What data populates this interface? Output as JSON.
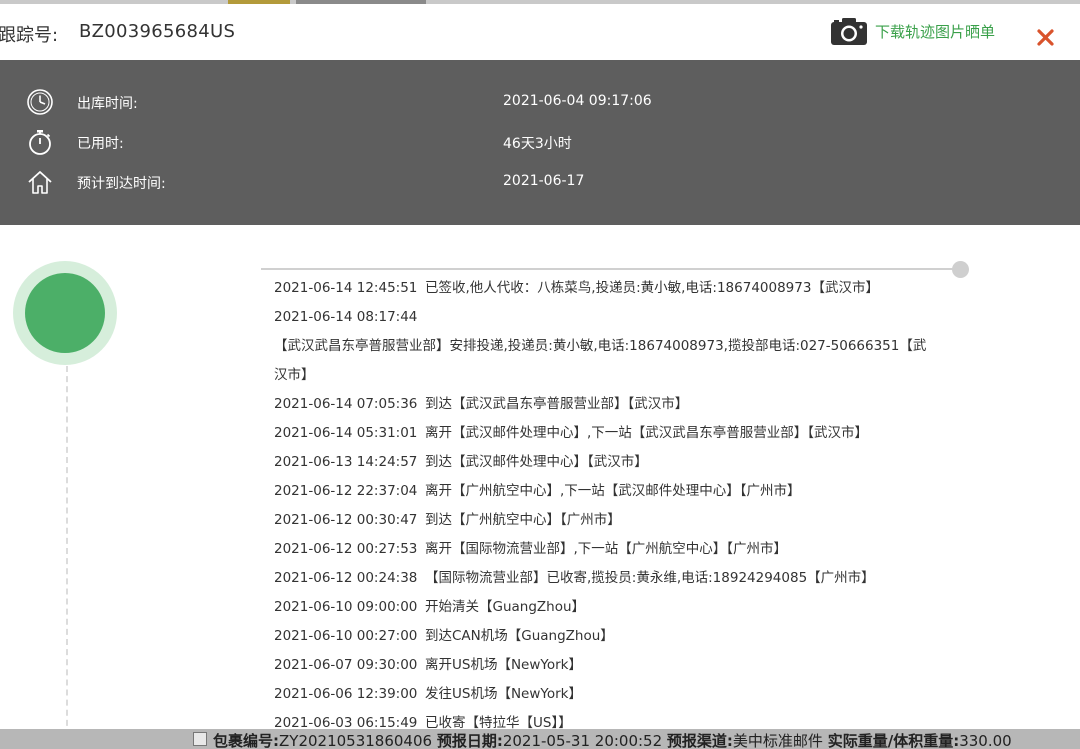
{
  "header": {
    "tracking_label": "跟踪号:",
    "tracking_number": "BZ003965684US",
    "download_label": "下载轨迹图片晒单"
  },
  "info": {
    "ship_time_label": "出库时间:",
    "ship_time_value": "2021-06-04 09:17:06",
    "elapsed_label": "已用时:",
    "elapsed_value": "46天3小时",
    "eta_label": "预计到达时间:",
    "eta_value": "2021-06-17"
  },
  "events": [
    {
      "time": "2021-06-14 12:45:51",
      "desc": "已签收,他人代收：八栋菜鸟,投递员:黄小敏,电话:18674008973【武汉市】"
    },
    {
      "time": "2021-06-14 08:17:44",
      "desc": ""
    },
    {
      "time": "",
      "desc": "【武汉武昌东亭普服营业部】安排投递,投递员:黄小敏,电话:18674008973,揽投部电话:027-50666351【武汉市】"
    },
    {
      "time": "2021-06-14 07:05:36",
      "desc": "到达【武汉武昌东亭普服营业部】【武汉市】"
    },
    {
      "time": "2021-06-14 05:31:01",
      "desc": "离开【武汉邮件处理中心】,下一站【武汉武昌东亭普服营业部】【武汉市】"
    },
    {
      "time": "2021-06-13 14:24:57",
      "desc": "到达【武汉邮件处理中心】【武汉市】"
    },
    {
      "time": "2021-06-12 22:37:04",
      "desc": "离开【广州航空中心】,下一站【武汉邮件处理中心】【广州市】"
    },
    {
      "time": "2021-06-12 00:30:47",
      "desc": "到达【广州航空中心】【广州市】"
    },
    {
      "time": "2021-06-12 00:27:53",
      "desc": "离开【国际物流营业部】,下一站【广州航空中心】【广州市】"
    },
    {
      "time": "2021-06-12 00:24:38",
      "desc": "【国际物流营业部】已收寄,揽投员:黄永维,电话:18924294085【广州市】"
    },
    {
      "time": "2021-06-10 09:00:00",
      "desc": "开始清关【GuangZhou】"
    },
    {
      "time": "2021-06-10 00:27:00",
      "desc": "到达CAN机场【GuangZhou】"
    },
    {
      "time": "2021-06-07 09:30:00",
      "desc": "离开US机场【NewYork】"
    },
    {
      "time": "2021-06-06 12:39:00",
      "desc": "发往US机场【NewYork】"
    },
    {
      "time": "2021-06-03 06:15:49",
      "desc": "已收寄【特拉华【US】】"
    }
  ],
  "order_bar": {
    "package_label": "包裹编号:",
    "package_value": "ZY20210531860406",
    "date_label": "预报日期:",
    "date_value": "2021-05-31 20:00:52",
    "channel_label": "预报渠道:",
    "channel_value": "美中标准邮件",
    "weight_label": "实际重量/体积重量:",
    "weight_value": "330.00"
  },
  "colors": {
    "accent_green": "#3aa04a",
    "status_green": "#4caf68",
    "banner_gray": "#5e5e5e",
    "close_red": "#d9532c"
  }
}
